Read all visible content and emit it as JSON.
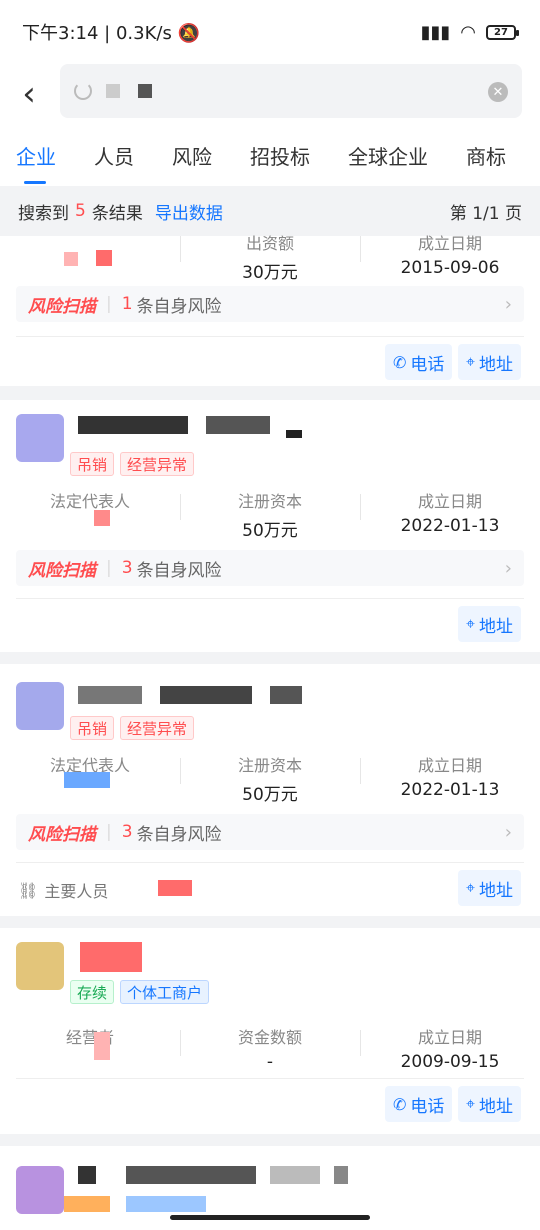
{
  "status": {
    "time": "下午3:14",
    "speed": "0.3K/s",
    "battery": "27"
  },
  "tabs": [
    "企业",
    "人员",
    "风险",
    "招投标",
    "全球企业",
    "商标"
  ],
  "summary": {
    "prefix": "搜索到",
    "count": "5",
    "suffix": "条结果",
    "export": "导出数据",
    "page": "第 1/1 页"
  },
  "cards": [
    {
      "info": [
        {
          "label": "",
          "value": ""
        },
        {
          "label": "出资额",
          "value": "30万元"
        },
        {
          "label": "成立日期",
          "value": "2015-09-06"
        }
      ],
      "risk": {
        "brand": "风险扫描",
        "num": "1",
        "text": "条自身风险"
      },
      "actions": [
        "电话",
        "地址"
      ]
    },
    {
      "tags": [
        "吊销",
        "经营异常"
      ],
      "info": [
        {
          "label": "法定代表人",
          "value": ""
        },
        {
          "label": "注册资本",
          "value": "50万元"
        },
        {
          "label": "成立日期",
          "value": "2022-01-13"
        }
      ],
      "risk": {
        "brand": "风险扫描",
        "num": "3",
        "text": "条自身风险"
      },
      "actions": [
        "地址"
      ]
    },
    {
      "tags": [
        "吊销",
        "经营异常"
      ],
      "info": [
        {
          "label": "法定代表人",
          "value": ""
        },
        {
          "label": "注册资本",
          "value": "50万元"
        },
        {
          "label": "成立日期",
          "value": "2022-01-13"
        }
      ],
      "risk": {
        "brand": "风险扫描",
        "num": "3",
        "text": "条自身风险"
      },
      "mainperson": "主要人员",
      "actions": [
        "地址"
      ]
    },
    {
      "tags": [
        "存续",
        "个体工商户"
      ],
      "info": [
        {
          "label": "经营者",
          "value": ""
        },
        {
          "label": "资金数额",
          "value": "-"
        },
        {
          "label": "成立日期",
          "value": "2009-09-15"
        }
      ],
      "actions": [
        "电话",
        "地址"
      ]
    }
  ],
  "colors": {
    "accent": "#1677ff",
    "danger": "#ff4d4f",
    "success": "#1aaa55"
  }
}
